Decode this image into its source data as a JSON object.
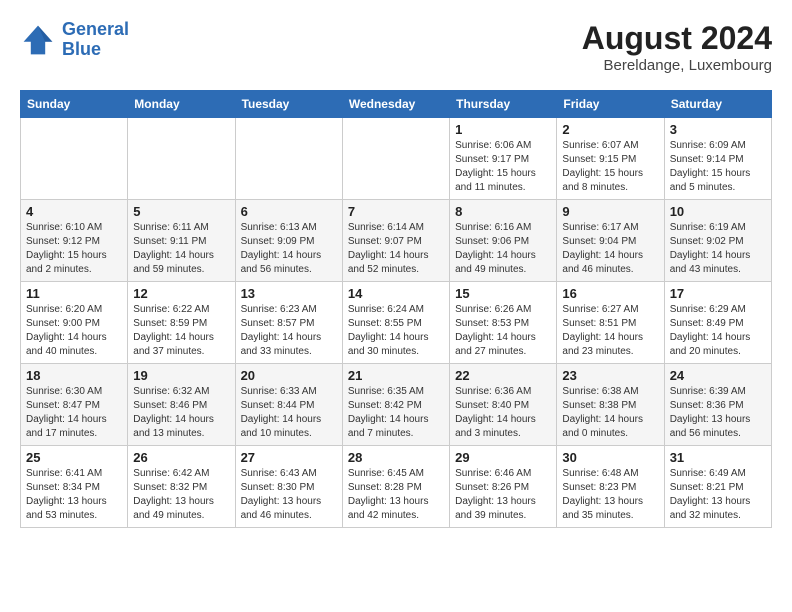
{
  "logo": {
    "line1": "General",
    "line2": "Blue"
  },
  "title": "August 2024",
  "location": "Bereldange, Luxembourg",
  "weekdays": [
    "Sunday",
    "Monday",
    "Tuesday",
    "Wednesday",
    "Thursday",
    "Friday",
    "Saturday"
  ],
  "weeks": [
    [
      {
        "day": "",
        "info": ""
      },
      {
        "day": "",
        "info": ""
      },
      {
        "day": "",
        "info": ""
      },
      {
        "day": "",
        "info": ""
      },
      {
        "day": "1",
        "info": "Sunrise: 6:06 AM\nSunset: 9:17 PM\nDaylight: 15 hours\nand 11 minutes."
      },
      {
        "day": "2",
        "info": "Sunrise: 6:07 AM\nSunset: 9:15 PM\nDaylight: 15 hours\nand 8 minutes."
      },
      {
        "day": "3",
        "info": "Sunrise: 6:09 AM\nSunset: 9:14 PM\nDaylight: 15 hours\nand 5 minutes."
      }
    ],
    [
      {
        "day": "4",
        "info": "Sunrise: 6:10 AM\nSunset: 9:12 PM\nDaylight: 15 hours\nand 2 minutes."
      },
      {
        "day": "5",
        "info": "Sunrise: 6:11 AM\nSunset: 9:11 PM\nDaylight: 14 hours\nand 59 minutes."
      },
      {
        "day": "6",
        "info": "Sunrise: 6:13 AM\nSunset: 9:09 PM\nDaylight: 14 hours\nand 56 minutes."
      },
      {
        "day": "7",
        "info": "Sunrise: 6:14 AM\nSunset: 9:07 PM\nDaylight: 14 hours\nand 52 minutes."
      },
      {
        "day": "8",
        "info": "Sunrise: 6:16 AM\nSunset: 9:06 PM\nDaylight: 14 hours\nand 49 minutes."
      },
      {
        "day": "9",
        "info": "Sunrise: 6:17 AM\nSunset: 9:04 PM\nDaylight: 14 hours\nand 46 minutes."
      },
      {
        "day": "10",
        "info": "Sunrise: 6:19 AM\nSunset: 9:02 PM\nDaylight: 14 hours\nand 43 minutes."
      }
    ],
    [
      {
        "day": "11",
        "info": "Sunrise: 6:20 AM\nSunset: 9:00 PM\nDaylight: 14 hours\nand 40 minutes."
      },
      {
        "day": "12",
        "info": "Sunrise: 6:22 AM\nSunset: 8:59 PM\nDaylight: 14 hours\nand 37 minutes."
      },
      {
        "day": "13",
        "info": "Sunrise: 6:23 AM\nSunset: 8:57 PM\nDaylight: 14 hours\nand 33 minutes."
      },
      {
        "day": "14",
        "info": "Sunrise: 6:24 AM\nSunset: 8:55 PM\nDaylight: 14 hours\nand 30 minutes."
      },
      {
        "day": "15",
        "info": "Sunrise: 6:26 AM\nSunset: 8:53 PM\nDaylight: 14 hours\nand 27 minutes."
      },
      {
        "day": "16",
        "info": "Sunrise: 6:27 AM\nSunset: 8:51 PM\nDaylight: 14 hours\nand 23 minutes."
      },
      {
        "day": "17",
        "info": "Sunrise: 6:29 AM\nSunset: 8:49 PM\nDaylight: 14 hours\nand 20 minutes."
      }
    ],
    [
      {
        "day": "18",
        "info": "Sunrise: 6:30 AM\nSunset: 8:47 PM\nDaylight: 14 hours\nand 17 minutes."
      },
      {
        "day": "19",
        "info": "Sunrise: 6:32 AM\nSunset: 8:46 PM\nDaylight: 14 hours\nand 13 minutes."
      },
      {
        "day": "20",
        "info": "Sunrise: 6:33 AM\nSunset: 8:44 PM\nDaylight: 14 hours\nand 10 minutes."
      },
      {
        "day": "21",
        "info": "Sunrise: 6:35 AM\nSunset: 8:42 PM\nDaylight: 14 hours\nand 7 minutes."
      },
      {
        "day": "22",
        "info": "Sunrise: 6:36 AM\nSunset: 8:40 PM\nDaylight: 14 hours\nand 3 minutes."
      },
      {
        "day": "23",
        "info": "Sunrise: 6:38 AM\nSunset: 8:38 PM\nDaylight: 14 hours\nand 0 minutes."
      },
      {
        "day": "24",
        "info": "Sunrise: 6:39 AM\nSunset: 8:36 PM\nDaylight: 13 hours\nand 56 minutes."
      }
    ],
    [
      {
        "day": "25",
        "info": "Sunrise: 6:41 AM\nSunset: 8:34 PM\nDaylight: 13 hours\nand 53 minutes."
      },
      {
        "day": "26",
        "info": "Sunrise: 6:42 AM\nSunset: 8:32 PM\nDaylight: 13 hours\nand 49 minutes."
      },
      {
        "day": "27",
        "info": "Sunrise: 6:43 AM\nSunset: 8:30 PM\nDaylight: 13 hours\nand 46 minutes."
      },
      {
        "day": "28",
        "info": "Sunrise: 6:45 AM\nSunset: 8:28 PM\nDaylight: 13 hours\nand 42 minutes."
      },
      {
        "day": "29",
        "info": "Sunrise: 6:46 AM\nSunset: 8:26 PM\nDaylight: 13 hours\nand 39 minutes."
      },
      {
        "day": "30",
        "info": "Sunrise: 6:48 AM\nSunset: 8:23 PM\nDaylight: 13 hours\nand 35 minutes."
      },
      {
        "day": "31",
        "info": "Sunrise: 6:49 AM\nSunset: 8:21 PM\nDaylight: 13 hours\nand 32 minutes."
      }
    ]
  ]
}
